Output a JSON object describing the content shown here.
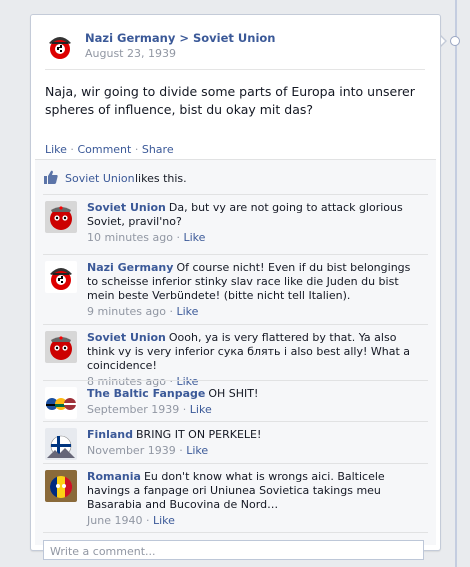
{
  "post": {
    "author": "Nazi Germany > Soviet Union",
    "date": "August 23, 1939",
    "body": "Naja, wir going to divide some parts of Europa into unserer spheres of influence, bist du okay mit das?",
    "actions": {
      "like": "Like",
      "comment": "Comment",
      "share": "Share",
      "sep": " · "
    }
  },
  "likes": {
    "who": "Soviet Union",
    "rest": "likes this."
  },
  "comments": [
    {
      "author": "Soviet Union",
      "text": "Da, but vy are not going to attack glorious Soviet, pravil'no?",
      "time": "10 minutes ago",
      "like": "Like",
      "avatar": "soviet-avatar"
    },
    {
      "author": "Nazi Germany",
      "text": "Of course nicht! Even if du bist belongings to scheisse inferior stinky slav race like die Juden du bist mein beste Verbündete! (bitte nicht tell Italien).",
      "time": "9 minutes ago",
      "like": "Like",
      "avatar": "germany-avatar"
    },
    {
      "author": "Soviet Union",
      "text": "Oooh, ya is very flattered by that. Ya also think vy is very inferior сука блять i also best ally! What a coincidence!",
      "time": "8 minutes ago",
      "like": "Like",
      "avatar": "soviet-avatar"
    },
    {
      "author": "The Baltic Fanpage",
      "text": "OH SHIT!",
      "time": "September 1939",
      "like": "Like",
      "avatar": "baltic-avatar"
    },
    {
      "author": "Finland",
      "text": "BRING IT ON PERKELE!",
      "time": "November 1939",
      "like": "Like",
      "avatar": "finland-avatar"
    },
    {
      "author": "Romania",
      "text": "Eu don't know what is wrongs aici. Balticele havings a fanpage ori Uniunea Sovietica takings meu Basarabia and Bucovina de Nord…",
      "time": "June 1940",
      "like": "Like",
      "avatar": "romania-avatar"
    }
  ],
  "write_comment": {
    "placeholder": "Write a comment..."
  },
  "colors": {
    "link": "#3b5998",
    "meta": "#9197a3",
    "background": "#e9ebee"
  }
}
